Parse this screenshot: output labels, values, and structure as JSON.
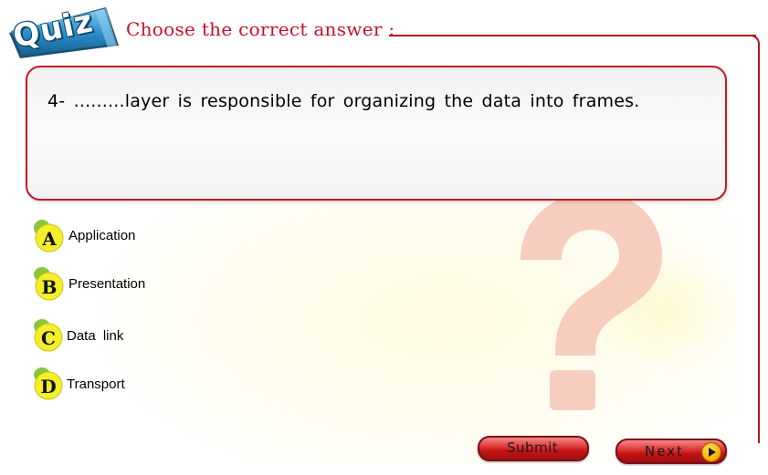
{
  "header": {
    "badge": "Quiz",
    "title": "Choose the correct answer :"
  },
  "question": {
    "text": "4- .........layer is responsible for organizing the data into frames."
  },
  "options": [
    {
      "letter": "A",
      "label": "Application",
      "icon": "letter-a-bubble-icon"
    },
    {
      "letter": "B",
      "label": "Presentation",
      "icon": "letter-b-bubble-icon"
    },
    {
      "letter": "C",
      "label": "Data link",
      "icon": "letter-c-bubble-icon"
    },
    {
      "letter": "D",
      "label": "Transport",
      "icon": "letter-d-bubble-icon"
    }
  ],
  "buttons": {
    "submit": "Submit",
    "next": "Next",
    "next_icon": "play-arrow-icon"
  },
  "decorations": {
    "background_icon": "question-mark-icon"
  },
  "colors": {
    "accent_red": "#c8102e",
    "border_red": "#b5121b",
    "badge_blue": "#1e6fa0",
    "option_yellow": "#f4ef2a",
    "option_green": "#8cc63f"
  }
}
